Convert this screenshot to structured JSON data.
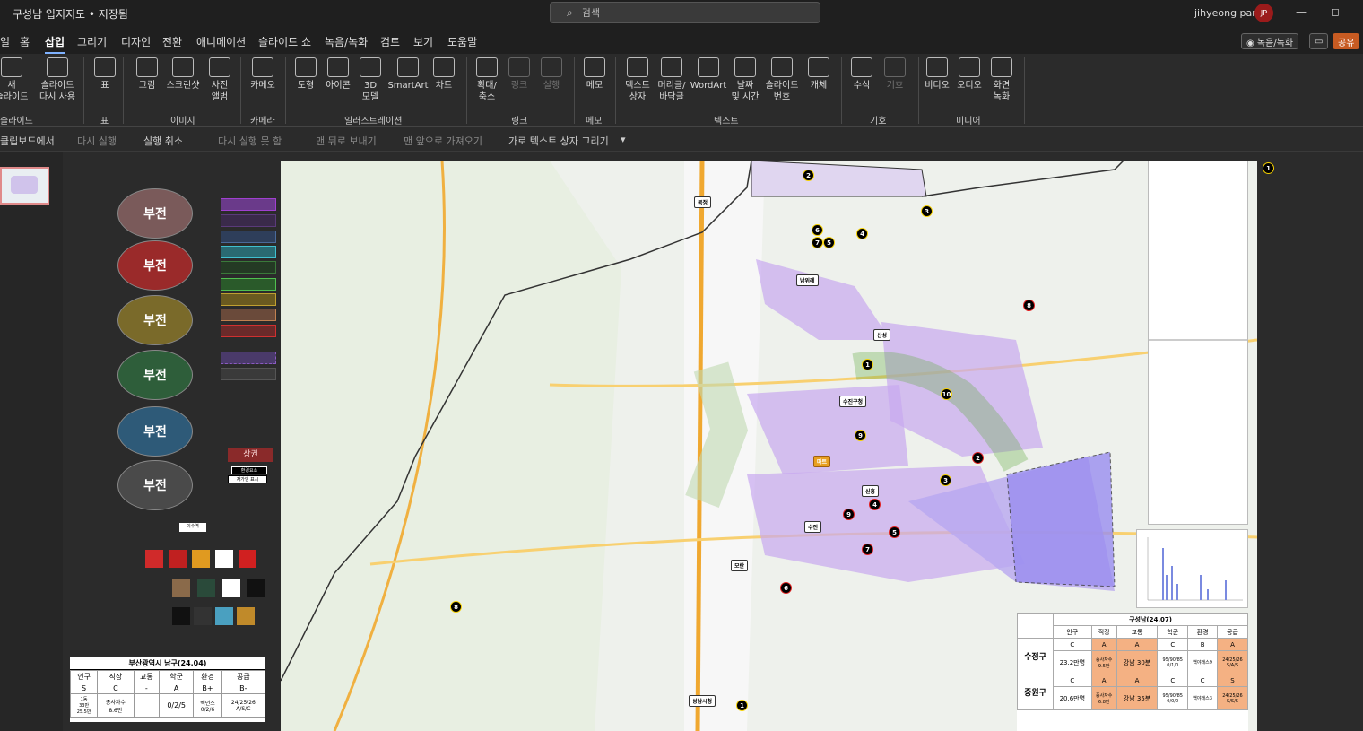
{
  "titlebar": {
    "doc_title": "구성남 입지지도 • 저장됨",
    "search_placeholder": "검색",
    "user_name": "jihyeong park",
    "avatar_initials": "JP",
    "minimize": "—",
    "restore": "◻"
  },
  "menu": {
    "tabs": [
      "일",
      "홈",
      "삽입",
      "그리기",
      "디자인",
      "전환",
      "애니메이션",
      "슬라이드 쇼",
      "녹음/녹화",
      "검토",
      "보기",
      "도움말"
    ],
    "record_button": "◉ 녹음/녹화",
    "comment_button": "▭",
    "share_button": "공유"
  },
  "ribbon": {
    "items": [
      {
        "label": "새\n슬라이드"
      },
      {
        "label": "슬라이드\n다시 사용"
      },
      {
        "label": "표"
      },
      {
        "label": "그림"
      },
      {
        "label": "스크린샷"
      },
      {
        "label": "사진\n앨범"
      },
      {
        "label": "카메오"
      },
      {
        "label": "도형"
      },
      {
        "label": "아이콘"
      },
      {
        "label": "3D\n모델"
      },
      {
        "label": "SmartArt"
      },
      {
        "label": "차트"
      },
      {
        "label": "확대/\n축소"
      },
      {
        "label": "링크"
      },
      {
        "label": "실행"
      },
      {
        "label": "메모"
      },
      {
        "label": "텍스트\n상자"
      },
      {
        "label": "머리글/\n바닥글"
      },
      {
        "label": "WordArt"
      },
      {
        "label": "날짜\n및 시간"
      },
      {
        "label": "슬라이드\n번호"
      },
      {
        "label": "개체"
      },
      {
        "label": "수식"
      },
      {
        "label": "기호"
      },
      {
        "label": "비디오"
      },
      {
        "label": "오디오"
      },
      {
        "label": "화면\n녹화"
      }
    ],
    "groups": [
      "슬라이드",
      "표",
      "이미지",
      "카메라",
      "일러스트레이션",
      "링크",
      "메모",
      "텍스트",
      "기호",
      "미디어"
    ]
  },
  "qat": {
    "clipboard": "클립보드에서",
    "redo": "다시 실행",
    "undo": "실행 취소",
    "cannot_redo": "다시 실행 못 함",
    "send_back": "맨 뒤로 보내기",
    "bring_front": "맨 앞으로 가져오기",
    "draw_textbox": "가로 텍스트 상자 그리기"
  },
  "slide_left": {
    "ovals": [
      "부전",
      "부전",
      "부전",
      "부전",
      "부전",
      "부전"
    ],
    "sangkwon": "상권",
    "notes": [
      "환경요소",
      "자가인 표시"
    ],
    "labels": [
      "이수역"
    ],
    "busan_table": {
      "title": "부산광역시 남구(24.04)",
      "headers": [
        "인구",
        "직장",
        "교통",
        "학군",
        "환경",
        "공급"
      ],
      "grades": [
        "S",
        "C",
        "-",
        "A",
        "B+",
        "B-"
      ],
      "values": [
        "1동\n33만\n25.5만",
        "종사자수\n8.6만",
        "",
        "0/2/5",
        "백년스\n0/2/6",
        "24/25/26\nA/S/C"
      ]
    }
  },
  "map": {
    "labels": [
      "복정",
      "남위례",
      "산성",
      "수진구청",
      "신흥",
      "수진",
      "모란",
      "마트",
      "성남시청"
    ],
    "markers": [
      "1",
      "2",
      "3",
      "4",
      "5",
      "6",
      "7",
      "8",
      "9",
      "10"
    ]
  },
  "compare_table": {
    "title": "구성남(24.07)",
    "headers": [
      "인구",
      "직장",
      "교통",
      "학군",
      "환경",
      "공급"
    ],
    "rows": [
      {
        "name": "수정구",
        "grades": [
          "C",
          "A",
          "A",
          "C",
          "B",
          "A"
        ],
        "values": [
          "23.2만명",
          "종사자수\n9.5만",
          "강남 30분",
          "95/90/85\n0/1/0",
          "백야래스9",
          "24/25/26\nS/A/S"
        ]
      },
      {
        "name": "중원구",
        "grades": [
          "C",
          "A",
          "A",
          "C",
          "C",
          "S"
        ],
        "values": [
          "20.6만명",
          "종사자수\n6.8만",
          "강남 35분",
          "95/90/85\n0/0/0",
          "백야래스3",
          "24/25/26\nS/S/S"
        ]
      }
    ]
  }
}
